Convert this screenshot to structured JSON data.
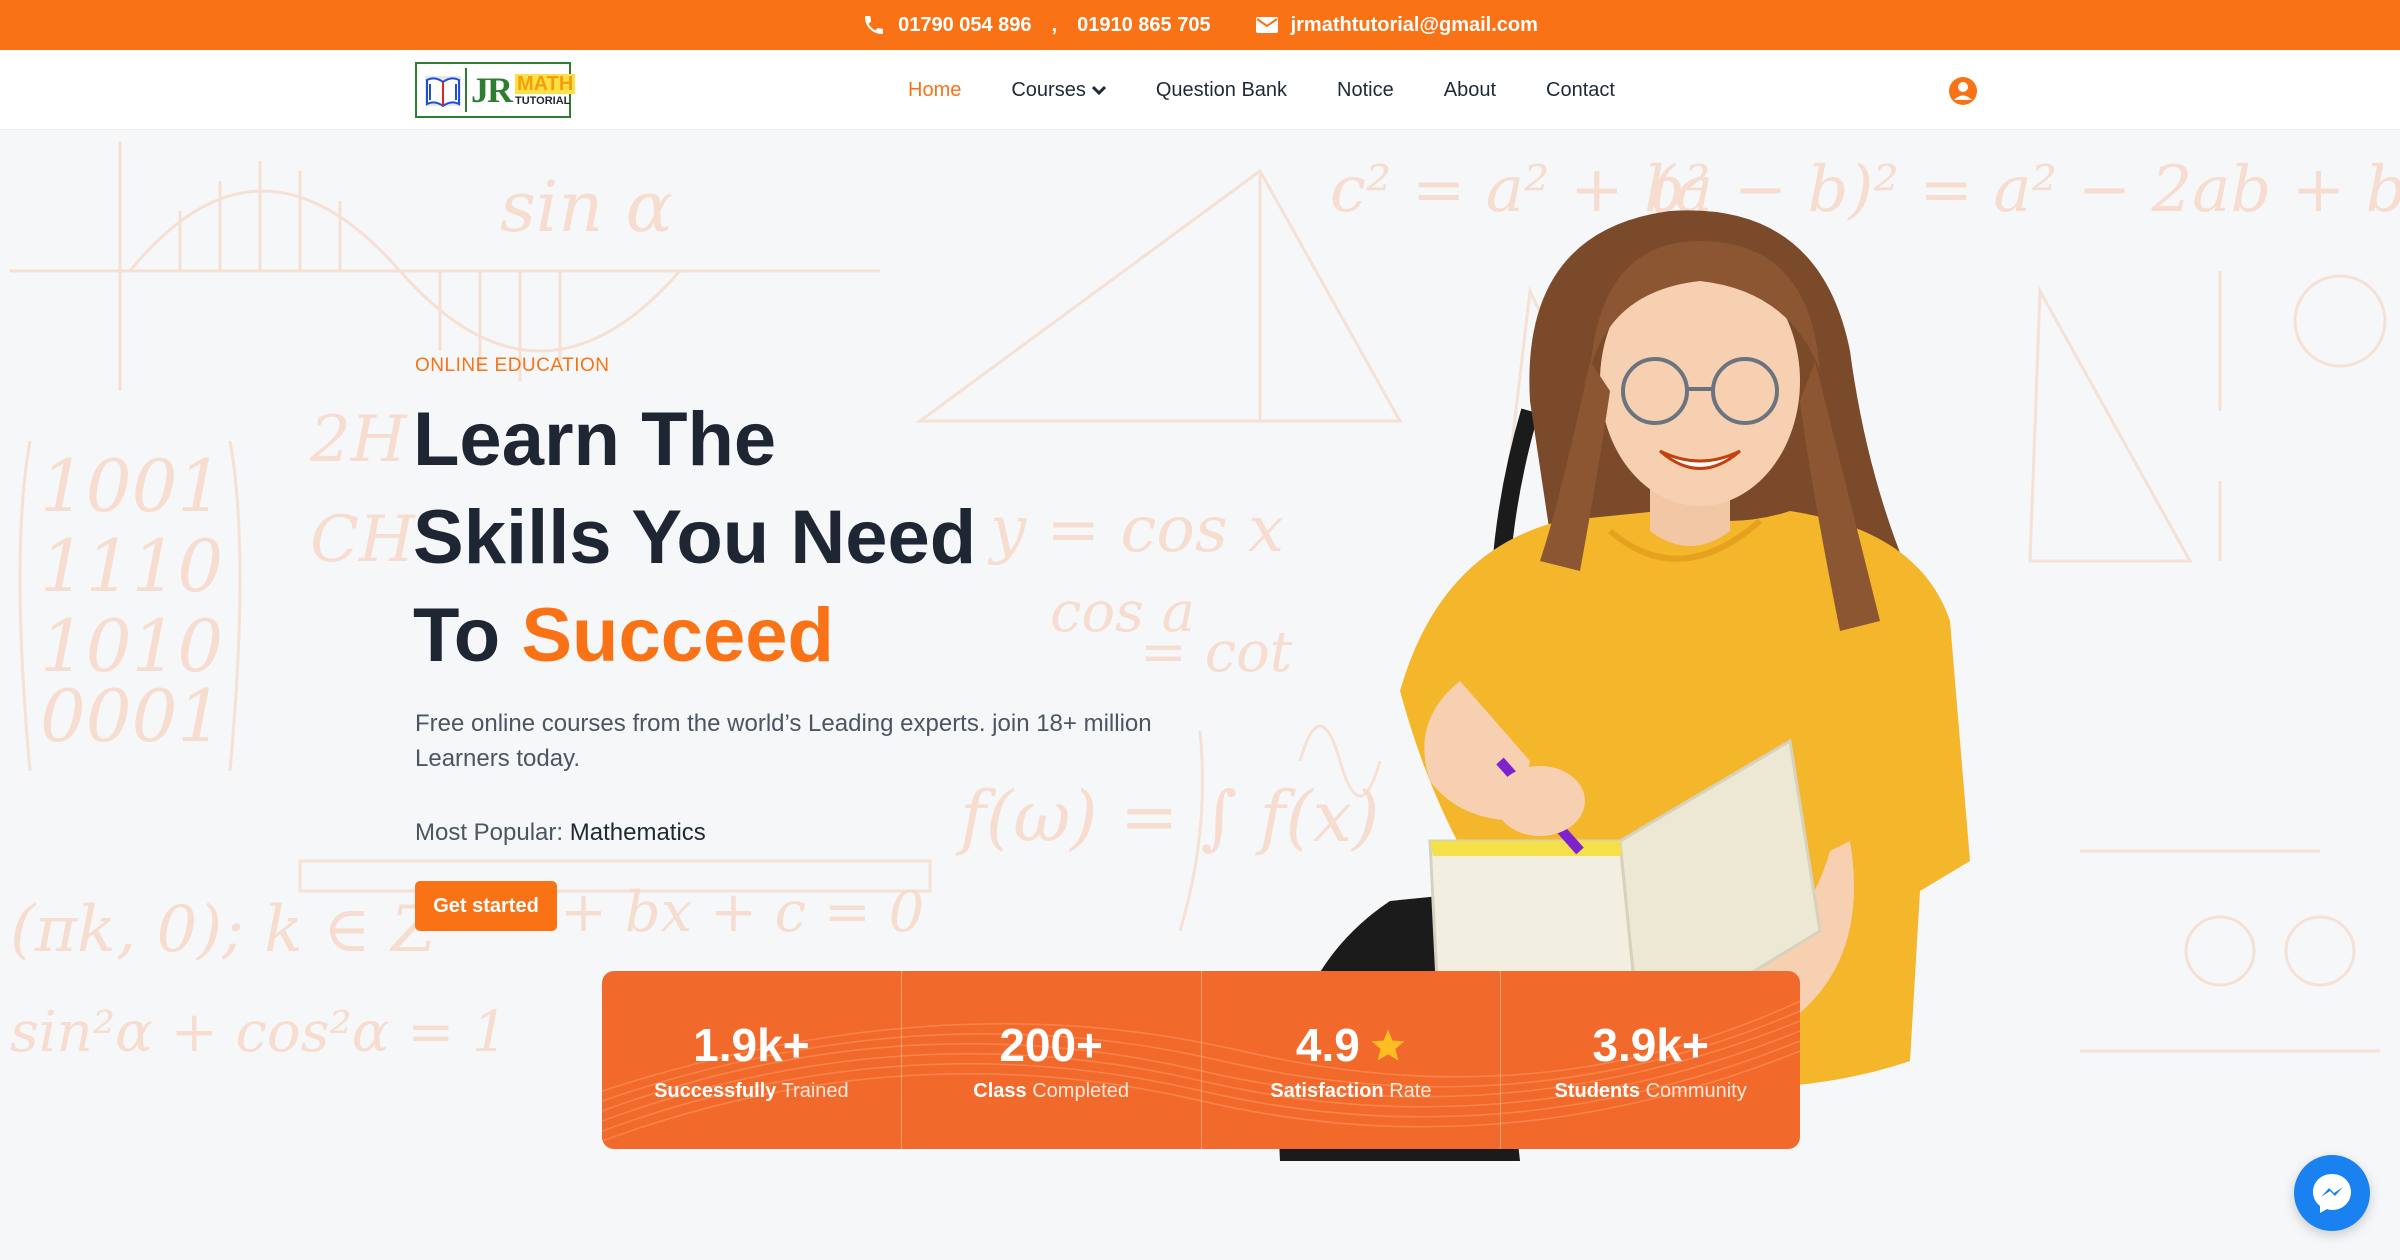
{
  "topbar": {
    "phone1": "01790 054 896",
    "phone_sep": ",",
    "phone2": "01910 865 705",
    "email": "jrmathtutorial@gmail.com"
  },
  "logo": {
    "jr": "JR",
    "math": "MATH",
    "tutorial": "TUTORIAL"
  },
  "nav": {
    "items": [
      {
        "label": "Home",
        "active": true
      },
      {
        "label": "Courses",
        "dropdown": true
      },
      {
        "label": "Question Bank"
      },
      {
        "label": "Notice"
      },
      {
        "label": "About"
      },
      {
        "label": "Contact"
      }
    ],
    "user_icon": "user-circle-icon"
  },
  "hero": {
    "eyebrow": "ONLINE EDUCATION",
    "line1": "Learn The",
    "line2": "Skills You Need",
    "line3_prefix": "To",
    "line3_accent": "Succeed",
    "subtitle": "Free online courses from the world’s Leading experts. join 18+ million Learners today.",
    "popular_label": "Most Popular:",
    "popular_value": "Mathematics",
    "cta": "Get started"
  },
  "stats": [
    {
      "value": "1.9k+",
      "bold": "Successfully",
      "rest": "Trained"
    },
    {
      "value": "200+",
      "bold": "Class",
      "rest": "Completed"
    },
    {
      "value": "4.9",
      "bold": "Satisfaction",
      "rest": "Rate",
      "icon": "star-icon"
    },
    {
      "value": "3.9k+",
      "bold": "Students",
      "rest": "Community"
    }
  ],
  "colors": {
    "accent": "#f97316",
    "stats_bg": "#f26a2b",
    "heading": "#1e2533",
    "messenger": "#1a82f0"
  },
  "floating": {
    "icon": "messenger-icon"
  }
}
